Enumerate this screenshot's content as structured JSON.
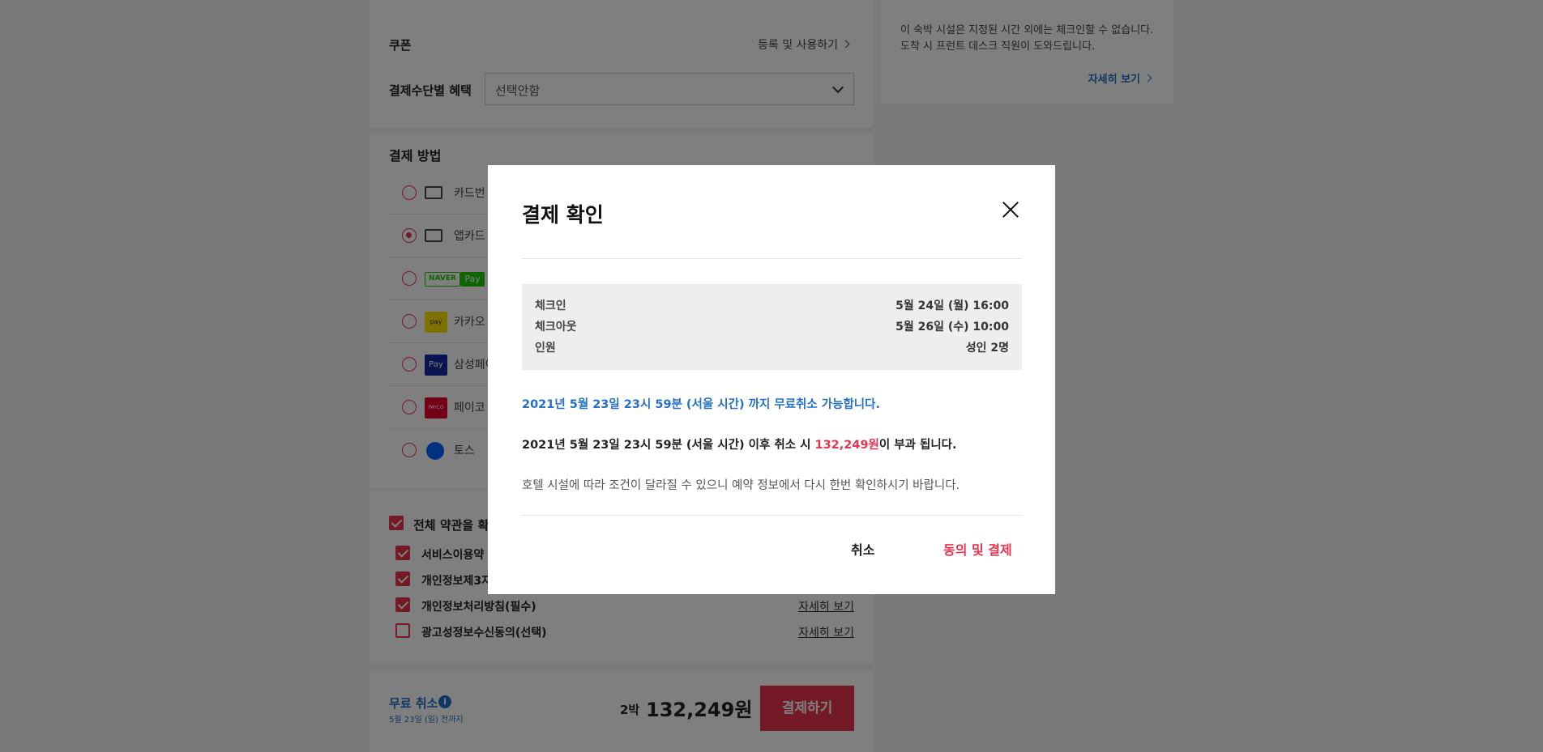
{
  "background": {
    "coupon": {
      "label": "쿠폰",
      "action": "등록 및 사용하기"
    },
    "card_benefit": {
      "label": "결제수단별 혜택",
      "select_value": "선택안함"
    },
    "payment_method": {
      "title": "결제 방법",
      "options": [
        {
          "label": "카드번",
          "selected": false
        },
        {
          "label": "앱카드",
          "selected": true
        },
        {
          "label": "Pay",
          "logo": "NAVER",
          "selected": false
        },
        {
          "label": "카카오",
          "logo": "pay",
          "selected": false
        },
        {
          "label": "삼성페이",
          "logo": "Pay",
          "selected": false
        },
        {
          "label": "페이코",
          "logo": "PAYCO",
          "selected": false
        },
        {
          "label": "토스",
          "selected": false
        }
      ]
    },
    "terms": {
      "all_label": "전체 약관을 확인",
      "items": [
        {
          "label": "서비스이용약",
          "checked": true,
          "link": ""
        },
        {
          "label": "개인정보제3자",
          "checked": true,
          "link": ""
        },
        {
          "label": "개인정보처리방침(필수)",
          "checked": true,
          "link": "자세히 보기"
        },
        {
          "label": "광고성정보수신동의(선택)",
          "checked": false,
          "link": "자세히 보기"
        }
      ]
    },
    "bottom": {
      "free_cancel": "무료 취소",
      "free_cancel_date": "5월 23일 (일) 전까지",
      "nights": "2박",
      "price": "132,249원",
      "pay_button": "결제하기"
    },
    "notice": {
      "text": "이 숙박 시설은 지정된 시간 외에는 체크인할 수 없습니다. 도착 시 프런트 데스크 직원이 도와드립니다.",
      "more": "자세히 보기"
    }
  },
  "modal": {
    "title": "결제 확인",
    "info": [
      {
        "key": "체크인",
        "value": "5월 24일 (월) 16:00"
      },
      {
        "key": "체크아웃",
        "value": "5월 26일 (수) 10:00"
      },
      {
        "key": "인원",
        "value": "성인 2명"
      }
    ],
    "free_cancel_notice": "2021년 5월 23일 23시 59분 (서울 시간) 까지 무료취소 가능합니다.",
    "fee_notice_prefix": "2021년 5월 23일 23시 59분 (서울 시간) 이후 취소 시 ",
    "fee_amount": "132,249원",
    "fee_notice_suffix": "이 부과 됩니다.",
    "hotel_note": "호텔 시설에 따라 조건이 달라질 수 있으니 예약 정보에서 다시 한번 확인하시기 바랍니다.",
    "cancel_button": "취소",
    "confirm_button": "동의 및 결제"
  },
  "colors": {
    "accent": "#e8344e",
    "link_blue": "#2371c9"
  }
}
